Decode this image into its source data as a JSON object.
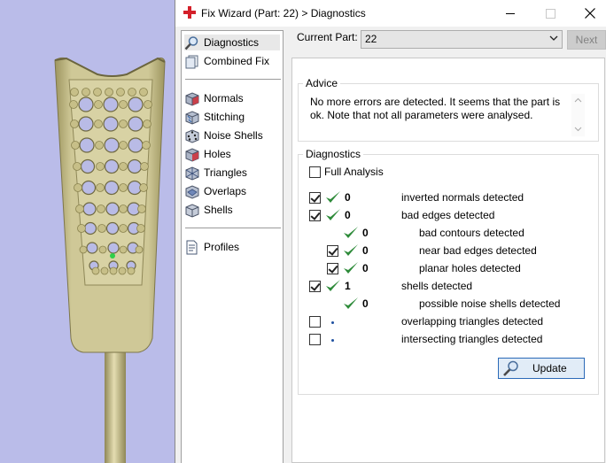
{
  "window": {
    "title": "Fix Wizard (Part: 22) > Diagnostics"
  },
  "sidebar": {
    "items": [
      {
        "label": "Diagnostics",
        "icon": "magnifier-icon",
        "selected": true
      },
      {
        "label": "Combined Fix",
        "icon": "pages-icon"
      },
      {
        "label": "Normals",
        "icon": "cube-icon"
      },
      {
        "label": "Stitching",
        "icon": "stitching-icon"
      },
      {
        "label": "Noise Shells",
        "icon": "dice-icon"
      },
      {
        "label": "Holes",
        "icon": "holes-icon"
      },
      {
        "label": "Triangles",
        "icon": "triangles-icon"
      },
      {
        "label": "Overlaps",
        "icon": "overlaps-icon"
      },
      {
        "label": "Shells",
        "icon": "shells-icon"
      },
      {
        "label": "Profiles",
        "icon": "document-icon"
      }
    ]
  },
  "header": {
    "current_part_label": "Current Part:",
    "current_part_value": "22",
    "next_label": "Next"
  },
  "advice": {
    "legend": "Advice",
    "text": "No more errors are detected. It seems that the part is ok. Note that not all parameters were analysed."
  },
  "diagnostics": {
    "legend": "Diagnostics",
    "full_analysis_label": "Full Analysis",
    "full_analysis_checked": false,
    "rows": [
      {
        "checked": true,
        "has_checkbox": true,
        "status": "ok",
        "count": "0",
        "label": "inverted normals detected"
      },
      {
        "checked": true,
        "has_checkbox": true,
        "status": "ok",
        "count": "0",
        "label": "bad edges detected"
      },
      {
        "checked": false,
        "has_checkbox": false,
        "status": "ok",
        "count": "0",
        "label": "bad contours detected"
      },
      {
        "checked": true,
        "has_checkbox": true,
        "status": "ok",
        "count": "0",
        "label": "near bad edges detected"
      },
      {
        "checked": true,
        "has_checkbox": true,
        "status": "ok",
        "count": "0",
        "label": "planar holes detected"
      },
      {
        "checked": true,
        "has_checkbox": true,
        "status": "ok",
        "count": "1",
        "label": "shells detected"
      },
      {
        "checked": false,
        "has_checkbox": false,
        "status": "ok",
        "count": "0",
        "label": "possible noise shells detected"
      },
      {
        "checked": false,
        "has_checkbox": true,
        "status": "not-run",
        "count": "",
        "label": "overlapping triangles detected"
      },
      {
        "checked": false,
        "has_checkbox": true,
        "status": "not-run",
        "count": "",
        "label": "intersecting triangles detected"
      }
    ],
    "update_label": "Update"
  },
  "colors": {
    "viewport_bg": "#babce9",
    "model": "#c9c191",
    "tick_green": "#2e8b3a",
    "accent_blue": "#2b6ab8"
  }
}
